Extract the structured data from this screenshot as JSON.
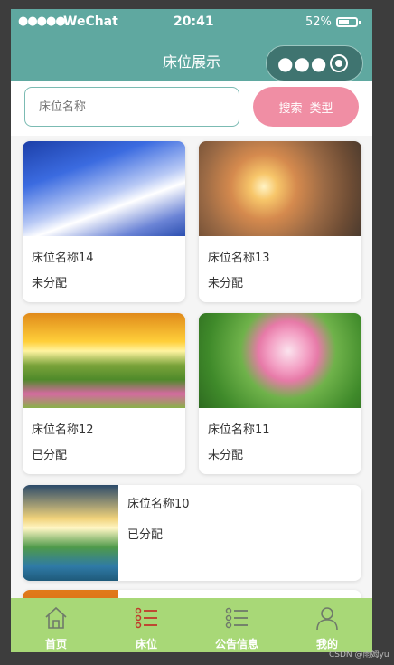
{
  "status_bar": {
    "signal": "●●●●●",
    "carrier": "WeChat",
    "time": "20:41",
    "battery": "52%"
  },
  "nav": {
    "title": "床位展示"
  },
  "search": {
    "placeholder": "床位名称",
    "button_text": "搜索",
    "button_sub": "类型"
  },
  "beds": [
    {
      "name": "床位名称14",
      "status": "未分配",
      "image": "sky-clouds"
    },
    {
      "name": "床位名称13",
      "status": "未分配",
      "image": "desert-sunset"
    },
    {
      "name": "床位名称12",
      "status": "已分配",
      "image": "flower-field"
    },
    {
      "name": "床位名称11",
      "status": "未分配",
      "image": "lotus"
    },
    {
      "name": "床位名称10",
      "status": "已分配",
      "image": "lake-sunrise"
    },
    {
      "name": "",
      "status": "",
      "image": "orange-partial"
    }
  ],
  "tabs": [
    {
      "label": "首页",
      "icon": "home-icon",
      "active": false
    },
    {
      "label": "床位",
      "icon": "list-icon",
      "active": true
    },
    {
      "label": "公告信息",
      "icon": "list-icon",
      "active": false
    },
    {
      "label": "我的",
      "icon": "user-icon",
      "active": false
    }
  ],
  "watermark": "CSDN @雨姆yu",
  "colors": {
    "header": "#5fa8a0",
    "search_button": "#f08ea4",
    "tabbar": "#a8d877",
    "active_icon": "#c0392b"
  }
}
